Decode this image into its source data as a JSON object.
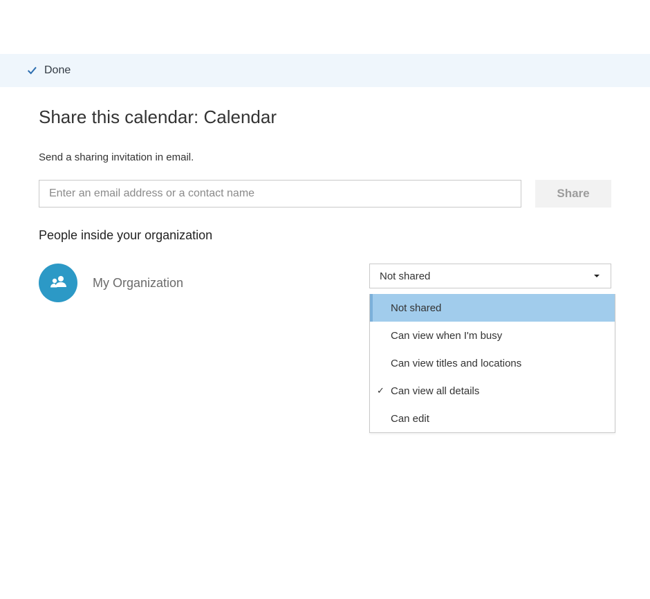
{
  "toolbar": {
    "done_label": "Done"
  },
  "page": {
    "title": "Share this calendar: Calendar",
    "help_text": "Send a sharing invitation in email.",
    "section_header": "People inside your organization"
  },
  "share": {
    "input_placeholder": "Enter an email address or a contact name",
    "button_label": "Share"
  },
  "org": {
    "name": "My Organization"
  },
  "permissions": {
    "selected": "Not shared",
    "options": [
      {
        "label": "Not shared",
        "highlight": true,
        "checked": false
      },
      {
        "label": "Can view when I'm busy",
        "highlight": false,
        "checked": false
      },
      {
        "label": "Can view titles and locations",
        "highlight": false,
        "checked": false
      },
      {
        "label": "Can view all details",
        "highlight": false,
        "checked": true
      },
      {
        "label": "Can edit",
        "highlight": false,
        "checked": false
      }
    ]
  }
}
